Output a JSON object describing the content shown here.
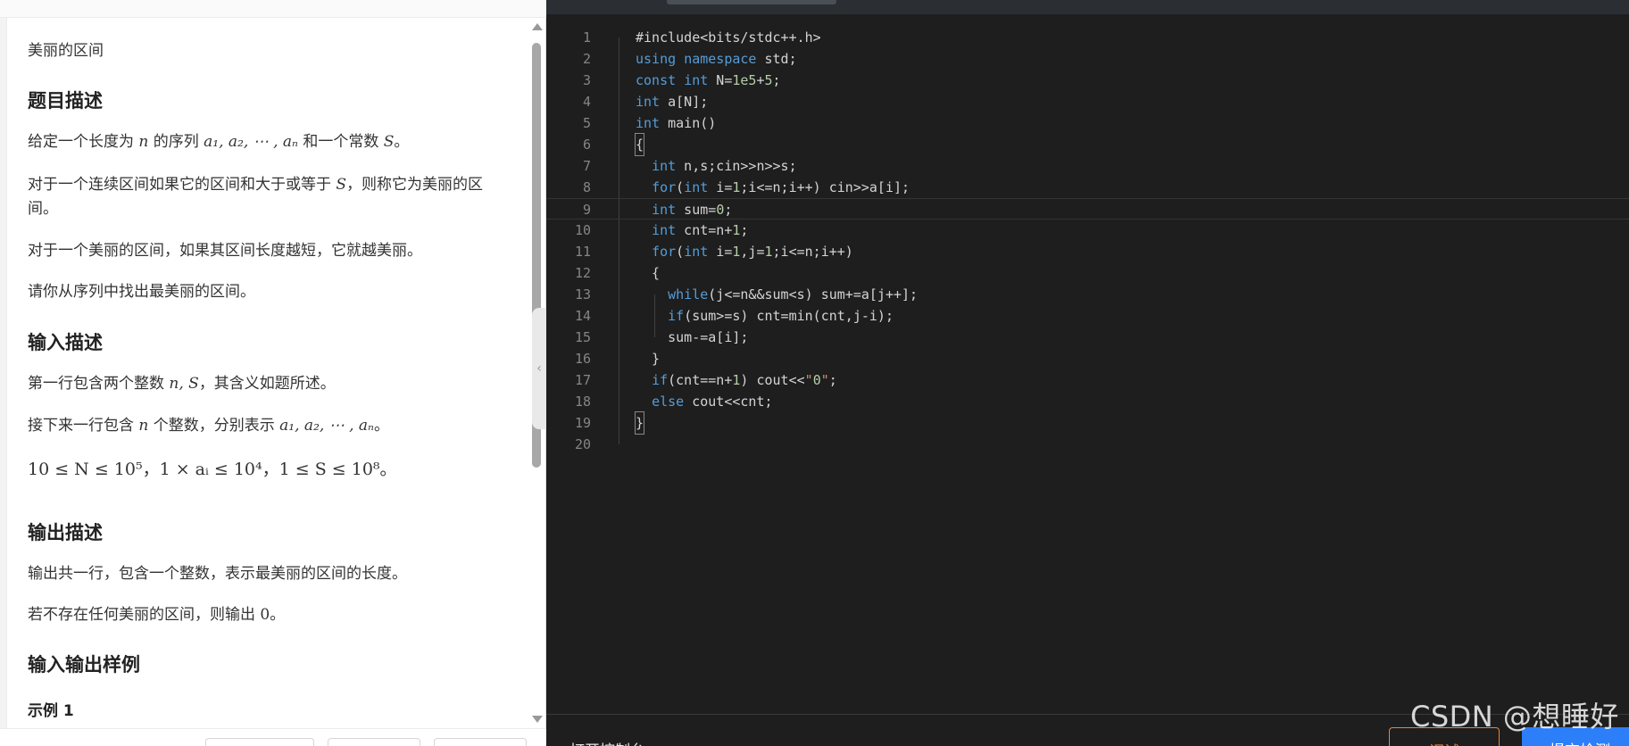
{
  "problem": {
    "title": "美丽的区间",
    "headings": {
      "description": "题目描述",
      "input": "输入描述",
      "output": "输出描述",
      "samples": "输入输出样例"
    },
    "description": {
      "p1_a": "给定一个长度为",
      "p1_n": "n",
      "p1_b": "的序列",
      "p1_seq": "a₁, a₂, ⋯ , aₙ",
      "p1_c": "和一个常数",
      "p1_S": "S",
      "p1_end": "。",
      "p2_a": "对于一个连续区间如果它的区间和大于或等于",
      "p2_S": "S",
      "p2_b": "，则称它为美丽的区间。",
      "p3": "对于一个美丽的区间，如果其区间长度越短，它就越美丽。",
      "p4": "请你从序列中找出最美丽的区间。"
    },
    "input": {
      "p1_a": "第一行包含两个整数",
      "p1_vars": "n, S",
      "p1_b": "，其含义如题所述。",
      "p2_a": "接下来一行包含",
      "p2_n": "n",
      "p2_b": "个整数，分别表示",
      "p2_seq": "a₁, a₂, ⋯ , aₙ",
      "p2_end": "。",
      "constraints": "10 ≤ N ≤ 10⁵，1 × aᵢ ≤ 10⁴，1 ≤ S ≤ 10⁸。"
    },
    "output": {
      "p1": "输出共一行，包含一个整数，表示最美丽的区间的长度。",
      "p2_a": "若不存在任何美丽的区间，则输出",
      "p2_zero": "0",
      "p2_end": "。"
    },
    "sample_title": "示例 1"
  },
  "editor": {
    "lines": [
      {
        "n": "1",
        "code": "#include<bits/stdc++.h>"
      },
      {
        "n": "2",
        "code": "using namespace std;"
      },
      {
        "n": "3",
        "code": "const int N=1e5+5;"
      },
      {
        "n": "4",
        "code": "int a[N];"
      },
      {
        "n": "5",
        "code": "int main()"
      },
      {
        "n": "6",
        "code": "{"
      },
      {
        "n": "7",
        "code": "  int n,s;cin>>n>>s;"
      },
      {
        "n": "8",
        "code": "  for(int i=1;i<=n;i++) cin>>a[i];"
      },
      {
        "n": "9",
        "code": "  int sum=0;"
      },
      {
        "n": "10",
        "code": "  int cnt=n+1;"
      },
      {
        "n": "11",
        "code": "  for(int i=1,j=1;i<=n;i++)"
      },
      {
        "n": "12",
        "code": "  {"
      },
      {
        "n": "13",
        "code": "    while(j<=n&&sum<s) sum+=a[j++];"
      },
      {
        "n": "14",
        "code": "    if(sum>=s) cnt=min(cnt,j-i);"
      },
      {
        "n": "15",
        "code": "    sum-=a[i];"
      },
      {
        "n": "16",
        "code": "  }"
      },
      {
        "n": "17",
        "code": "  if(cnt==n+1) cout<<\"0\";"
      },
      {
        "n": "18",
        "code": "  else cout<<cnt;"
      },
      {
        "n": "19",
        "code": "}"
      },
      {
        "n": "20",
        "code": ""
      }
    ],
    "console_label": "打开控制台",
    "debug_label": "调试",
    "submit_label": "提交检测"
  },
  "watermark": "CSDN @想睡好",
  "icons": {
    "collapse": "chevron-left-icon"
  }
}
